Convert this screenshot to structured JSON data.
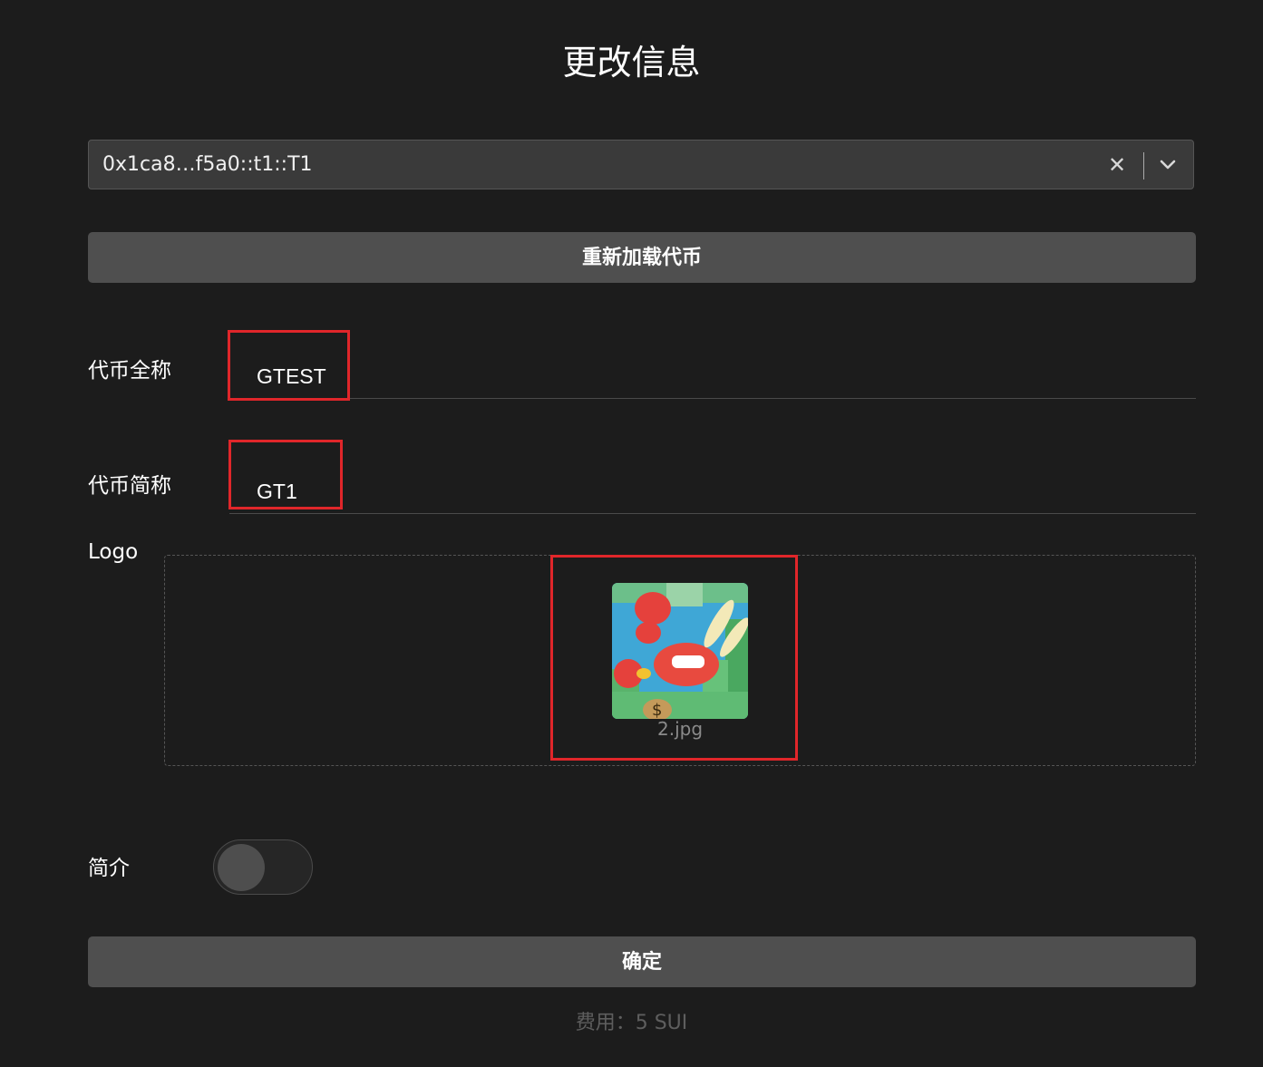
{
  "page": {
    "title": "更改信息"
  },
  "token_select": {
    "value": "0x1ca8…f5a0::t1::T1",
    "clear_icon": "✕",
    "chevron_icon": "chevron-down"
  },
  "reload_button": {
    "label": "重新加载代币"
  },
  "form": {
    "name_label": "代币全称",
    "name_value": "GTEST",
    "symbol_label": "代币简称",
    "symbol_value": "GT1",
    "logo_label": "Logo",
    "logo_filename": "2.jpg",
    "description_label": "简介",
    "description_enabled": false
  },
  "confirm_button": {
    "label": "确定"
  },
  "fee": "费用：5 SUI",
  "colors": {
    "background": "#1c1c1c",
    "button": "#4f4f4f",
    "highlight": "#e0262a"
  }
}
